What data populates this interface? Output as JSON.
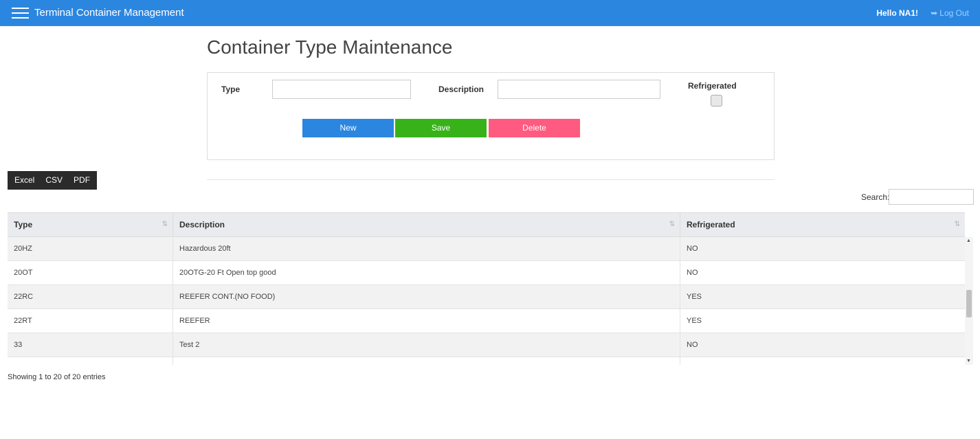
{
  "header": {
    "title": "Terminal Container Management",
    "greeting": "Hello NA1!",
    "logout_icon": "sign-out-icon",
    "logout_label": "Log Out",
    "color": "#2b86e0"
  },
  "page": {
    "title": "Container Type Maintenance"
  },
  "form": {
    "type_label": "Type",
    "type_value": "",
    "description_label": "Description",
    "description_value": "",
    "refrigerated_label": "Refrigerated",
    "refrigerated_checked": false,
    "new_label": "New",
    "save_label": "Save",
    "delete_label": "Delete",
    "colors": {
      "new": "#2b86e0",
      "save": "#37b219",
      "delete": "#ff5a7f"
    }
  },
  "export": {
    "buttons": [
      "Excel",
      "CSV",
      "PDF"
    ]
  },
  "search": {
    "label": "Search:",
    "value": ""
  },
  "table": {
    "columns": [
      "Type",
      "Description",
      "Refrigerated"
    ],
    "sort_icon": "⇅",
    "rows": [
      {
        "type": "20HZ",
        "description": "Hazardous 20ft",
        "refrigerated": "NO"
      },
      {
        "type": "20OT",
        "description": "20OTG-20 Ft Open top good",
        "refrigerated": "NO"
      },
      {
        "type": "22RC",
        "description": "REEFER CONT.(NO FOOD)",
        "refrigerated": "YES"
      },
      {
        "type": "22RT",
        "description": "REEFER",
        "refrigerated": "YES"
      },
      {
        "type": "33",
        "description": "Test 2",
        "refrigerated": "NO"
      },
      {
        "type": "",
        "description": "",
        "refrigerated": ""
      }
    ],
    "info": "Showing 1 to 20 of 20 entries"
  }
}
